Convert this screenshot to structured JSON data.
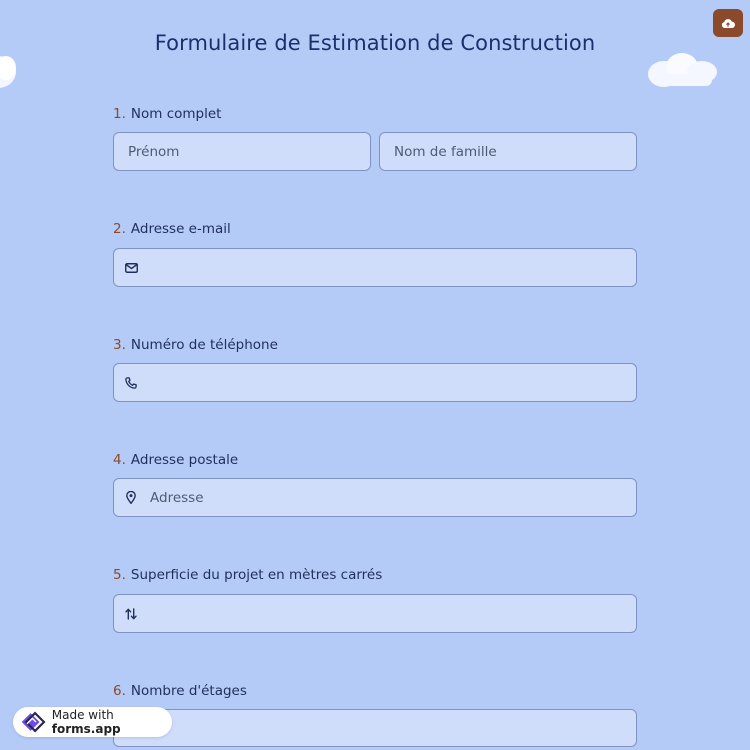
{
  "form": {
    "title": "Formulaire de Estimation de Construction"
  },
  "questions": [
    {
      "number": "1.",
      "label": "Nom complet",
      "fields": [
        {
          "placeholder": "Prénom"
        },
        {
          "placeholder": "Nom de famille"
        }
      ]
    },
    {
      "number": "2.",
      "label": "Adresse e-mail",
      "icon": "envelope-icon",
      "placeholder": ""
    },
    {
      "number": "3.",
      "label": "Numéro de téléphone",
      "icon": "phone-icon",
      "placeholder": ""
    },
    {
      "number": "4.",
      "label": "Adresse postale",
      "icon": "map-pin-icon",
      "placeholder": "Adresse"
    },
    {
      "number": "5.",
      "label": "Superficie du projet en mètres carrés",
      "icon": "sort-arrows-icon",
      "placeholder": ""
    },
    {
      "number": "6.",
      "label": "Nombre d'étages",
      "placeholder": ""
    }
  ],
  "footer": {
    "made_with": "Made with",
    "brand": "forms.app"
  },
  "colors": {
    "background": "#b5cbf7",
    "field_bg": "#cfddfb",
    "accent_brown": "#8a4a2b",
    "title": "#1c2f6b"
  }
}
